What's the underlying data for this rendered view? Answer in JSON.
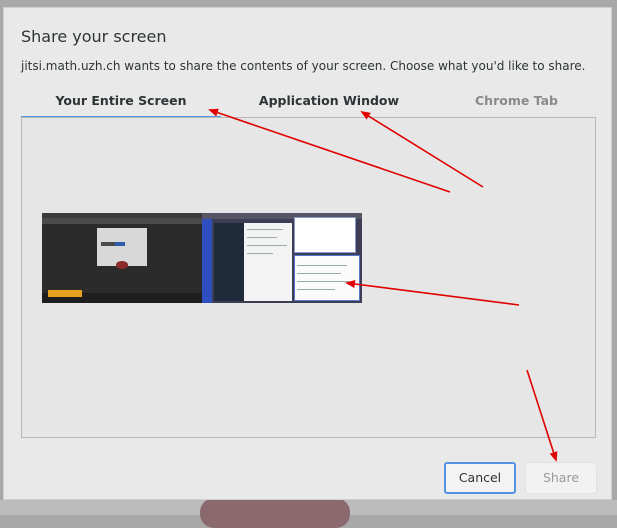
{
  "dialog": {
    "title": "Share your screen",
    "message": "jitsi.math.uzh.ch wants to share the contents of your screen. Choose what you'd like to share."
  },
  "tabs": [
    {
      "label": "Your Entire Screen",
      "selected": true
    },
    {
      "label": "Application Window",
      "selected": false
    },
    {
      "label": "Chrome Tab",
      "selected": false
    }
  ],
  "buttons": {
    "cancel_label": "Cancel",
    "share_label": "Share",
    "share_enabled": false
  },
  "colors": {
    "accent": "#5294e2",
    "annotation_arrow": "#e00000"
  },
  "icons": [
    "screen-thumbnail"
  ]
}
